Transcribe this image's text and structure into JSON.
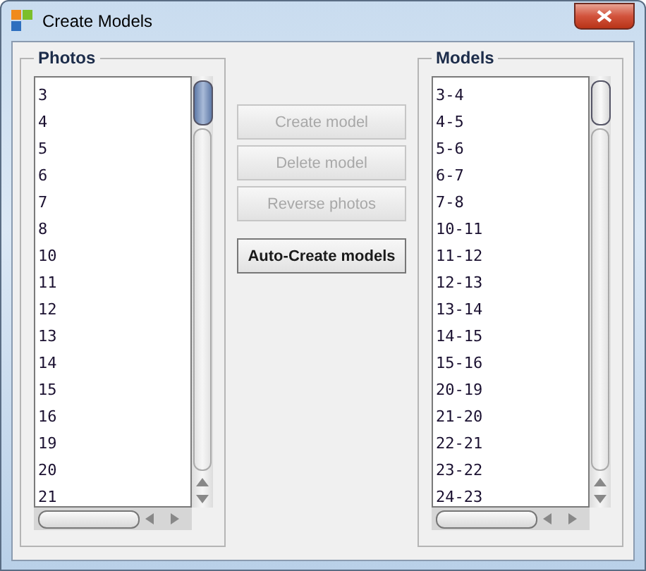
{
  "window": {
    "title": "Create Models"
  },
  "photos": {
    "title": "Photos",
    "items": [
      "3",
      "4",
      "5",
      "6",
      "7",
      "8",
      "10",
      "11",
      "12",
      "13",
      "14",
      "15",
      "16",
      "19",
      "20",
      "21"
    ]
  },
  "buttons": [
    {
      "label": "Create model",
      "disabled": true
    },
    {
      "label": "Delete model",
      "disabled": true
    },
    {
      "label": "Reverse photos",
      "disabled": true
    },
    {
      "label": "Auto-Create models",
      "disabled": false
    }
  ],
  "models": {
    "title": "Models",
    "items": [
      "3-4",
      "4-5",
      "5-6",
      "6-7",
      "7-8",
      "10-11",
      "11-12",
      "12-13",
      "13-14",
      "14-15",
      "15-16",
      "20-19",
      "21-20",
      "22-21",
      "23-22",
      "24-23"
    ]
  }
}
